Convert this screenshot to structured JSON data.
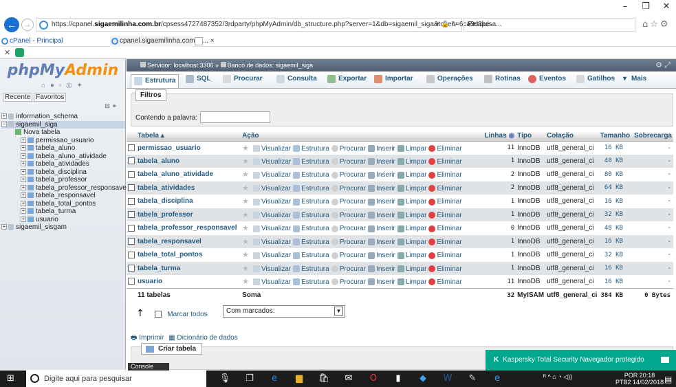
{
  "browser": {
    "url_prefix": "https://cpanel.",
    "url_domain": "sigaemilinha.com.br",
    "url_rest": "/cpsess4727487352/3rdparty/phpMyAdmin/db_structure.php?server=1&db=sigaemil_siga&token=6ca3d8be",
    "search_placeholder": "Pesquisa...",
    "tabs": [
      {
        "label": "cPanel - Principal"
      },
      {
        "label": "cpanel.sigaemilinha.com.br... ×"
      }
    ]
  },
  "nav": {
    "logo_php": "php",
    "logo_my": "My",
    "logo_admin": "Admin",
    "tab_recent": "Recente",
    "tab_favorites": "Favoritos",
    "tree": [
      {
        "label": "information_schema"
      },
      {
        "label": "sigaemil_siga"
      },
      {
        "label": "Nova tabela"
      },
      {
        "label": "permissao_usuario"
      },
      {
        "label": "tabela_aluno"
      },
      {
        "label": "tabela_aluno_atividade"
      },
      {
        "label": "tabela_atividades"
      },
      {
        "label": "tabela_disciplina"
      },
      {
        "label": "tabela_professor"
      },
      {
        "label": "tabela_professor_responsave"
      },
      {
        "label": "tabela_responsavel"
      },
      {
        "label": "tabela_total_pontos"
      },
      {
        "label": "tabela_turma"
      },
      {
        "label": "usuario"
      },
      {
        "label": "sigaemil_sisgam"
      }
    ]
  },
  "breadcrumb": {
    "server": "Servidor: localhost:3306",
    "sep": "»",
    "db": "Banco de dados: sigaemil_siga"
  },
  "menu": [
    {
      "label": "Estrutura"
    },
    {
      "label": "SQL"
    },
    {
      "label": "Procurar"
    },
    {
      "label": "Consulta"
    },
    {
      "label": "Exportar"
    },
    {
      "label": "Importar"
    },
    {
      "label": "Operações"
    },
    {
      "label": "Rotinas"
    },
    {
      "label": "Eventos"
    },
    {
      "label": "Gatilhos"
    },
    {
      "label": "Mais"
    }
  ],
  "filter": {
    "legend": "Filtros",
    "label": "Contendo a palavra:",
    "value": ""
  },
  "table": {
    "headers": {
      "name": "Tabela",
      "action": "Ação",
      "rows": "Linhas",
      "type": "Tipo",
      "collation": "Colação",
      "size": "Tamanho",
      "overhead": "Sobrecarga"
    },
    "actions": {
      "browse": "Visualizar",
      "structure": "Estrutura",
      "search": "Procurar",
      "insert": "Inserir",
      "empty": "Limpar",
      "drop": "Eliminar"
    },
    "rows": [
      {
        "name": "permissao_usuario",
        "rows": "11",
        "type": "InnoDB",
        "collation": "utf8_general_ci",
        "size": "16 KB",
        "overhead": "-"
      },
      {
        "name": "tabela_aluno",
        "rows": "1",
        "type": "InnoDB",
        "collation": "utf8_general_ci",
        "size": "48 KB",
        "overhead": "-"
      },
      {
        "name": "tabela_aluno_atividade",
        "rows": "2",
        "type": "InnoDB",
        "collation": "utf8_general_ci",
        "size": "80 KB",
        "overhead": "-"
      },
      {
        "name": "tabela_atividades",
        "rows": "2",
        "type": "InnoDB",
        "collation": "utf8_general_ci",
        "size": "64 KB",
        "overhead": "-"
      },
      {
        "name": "tabela_disciplina",
        "rows": "1",
        "type": "InnoDB",
        "collation": "utf8_general_ci",
        "size": "16 KB",
        "overhead": "-"
      },
      {
        "name": "tabela_professor",
        "rows": "1",
        "type": "InnoDB",
        "collation": "utf8_general_ci",
        "size": "32 KB",
        "overhead": "-"
      },
      {
        "name": "tabela_professor_responsavel",
        "rows": "0",
        "type": "InnoDB",
        "collation": "utf8_general_ci",
        "size": "48 KB",
        "overhead": "-"
      },
      {
        "name": "tabela_responsavel",
        "rows": "1",
        "type": "InnoDB",
        "collation": "utf8_general_ci",
        "size": "16 KB",
        "overhead": "-"
      },
      {
        "name": "tabela_total_pontos",
        "rows": "1",
        "type": "InnoDB",
        "collation": "utf8_general_ci",
        "size": "32 KB",
        "overhead": "-"
      },
      {
        "name": "tabela_turma",
        "rows": "1",
        "type": "InnoDB",
        "collation": "utf8_general_ci",
        "size": "16 KB",
        "overhead": "-"
      },
      {
        "name": "usuario",
        "rows": "11",
        "type": "InnoDB",
        "collation": "utf8_general_ci",
        "size": "16 KB",
        "overhead": "-"
      }
    ],
    "footer": {
      "count": "11 tabelas",
      "sum": "Soma",
      "rows": "32",
      "type": "MyISAM",
      "collation": "utf8_general_ci",
      "size": "384 KB",
      "overhead": "0 Bytes"
    }
  },
  "bulk": {
    "mark_all": "Marcar todos",
    "with_selected": "Com marcados:"
  },
  "links": {
    "print": "Imprimir",
    "dictionary": "Dicionário de dados"
  },
  "create": {
    "legend": "Criar tabela"
  },
  "console": {
    "label": "Console"
  },
  "kaspersky": {
    "text": "Kaspersky Total Security Navegador protegido"
  },
  "taskbar": {
    "search_placeholder": "Digite aqui para pesquisar",
    "lang1": "POR",
    "lang2": "PTB2",
    "time": "20:18",
    "date": "14/02/2018"
  }
}
